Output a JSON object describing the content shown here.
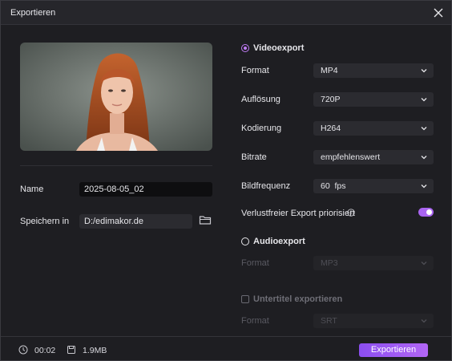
{
  "window": {
    "title": "Exportieren"
  },
  "left": {
    "name_label": "Name",
    "name_value": "2025-08-05_02",
    "save_label": "Speichern in",
    "save_path": "D:/edimakor.de"
  },
  "video": {
    "section_label": "Videoexport",
    "selected": true,
    "rows": [
      {
        "label": "Format",
        "value": "MP4"
      },
      {
        "label": "Auflösung",
        "value": "720P"
      },
      {
        "label": "Kodierung",
        "value": "H264"
      },
      {
        "label": "Bitrate",
        "value": "empfehlenswert"
      },
      {
        "label": "Bildfrequenz",
        "value": "60  fps"
      }
    ],
    "lossless_label": "Verlustfreier Export priorisiert",
    "lossless_on": true
  },
  "audio": {
    "section_label": "Audioexport",
    "selected": false,
    "format_label": "Format",
    "format_value": "MP3"
  },
  "subtitles": {
    "section_label": "Untertitel exportieren",
    "checked": false,
    "format_label": "Format",
    "format_value": "SRT"
  },
  "footer": {
    "duration": "00:02",
    "size": "1.9MB",
    "export_label": "Exportieren"
  },
  "colors": {
    "accent": "#a964f0",
    "background": "#1e1e22",
    "field": "#2b2b30"
  }
}
